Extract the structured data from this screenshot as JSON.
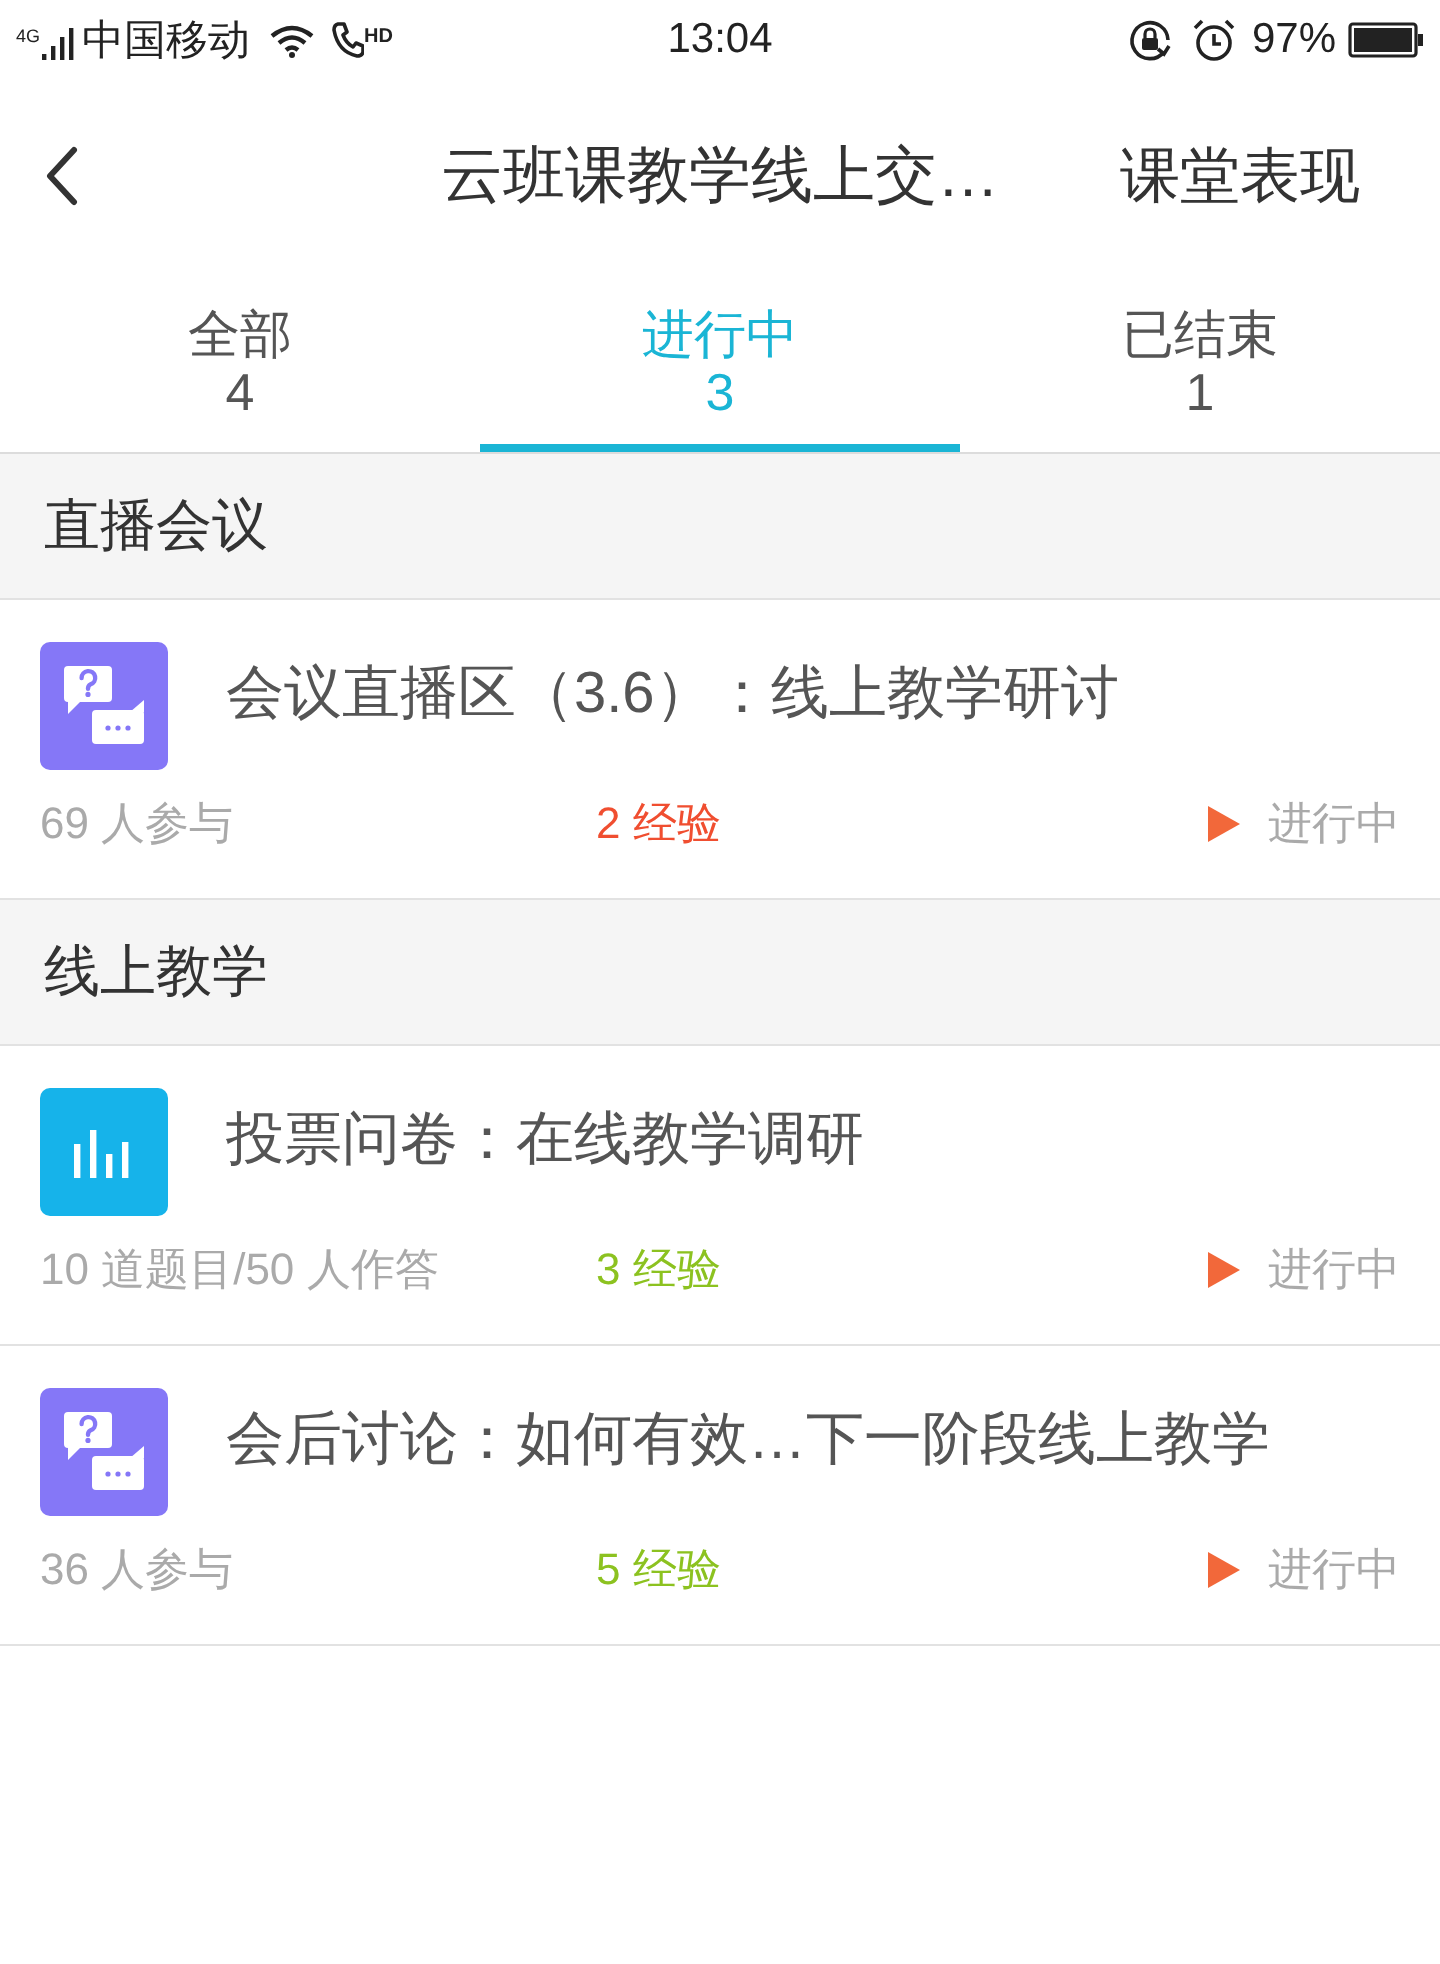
{
  "status_bar": {
    "network": "4G",
    "carrier": "中国移动",
    "call_badge": "HD",
    "time": "13:04",
    "battery": "97%"
  },
  "header": {
    "title": "云班课教学线上交…",
    "action": "课堂表现"
  },
  "tabs": [
    {
      "label": "全部",
      "count": "4",
      "selected": false
    },
    {
      "label": "进行中",
      "count": "3",
      "selected": true
    },
    {
      "label": "已结束",
      "count": "1",
      "selected": false
    }
  ],
  "sections": [
    {
      "title": "直播会议",
      "items": [
        {
          "kind": "discussion",
          "title": "会议直播区（3.6）：线上教学研讨",
          "meta": "69 人参与",
          "exp": {
            "text": "2 经验",
            "color": "#f04e30"
          },
          "status": "进行中"
        }
      ]
    },
    {
      "title": "线上教学",
      "items": [
        {
          "kind": "vote",
          "title": "投票问卷：在线教学调研",
          "meta": "10 道题目/50 人作答",
          "exp": {
            "text": "3 经验",
            "color": "#8cc220"
          },
          "status": "进行中"
        },
        {
          "kind": "discussion",
          "title": "会后讨论：如何有效…下一阶段线上教学",
          "meta": "36 人参与",
          "exp": {
            "text": "5 经验",
            "color": "#8cc220"
          },
          "status": "进行中"
        }
      ]
    }
  ]
}
